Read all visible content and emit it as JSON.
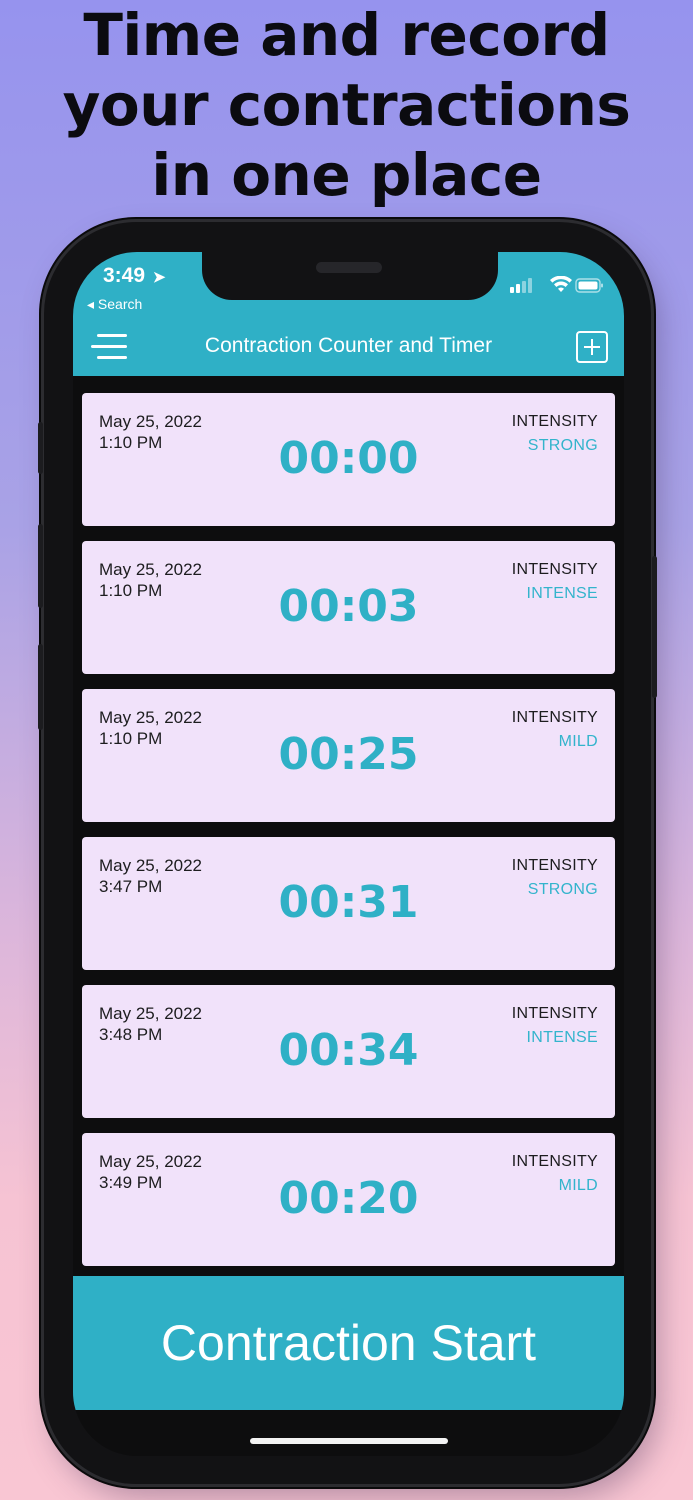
{
  "headline": [
    "Time and record",
    "your contractions",
    "in one place"
  ],
  "status_bar": {
    "time": "3:49",
    "back_label": "◂ Search"
  },
  "app_bar": {
    "title": "Contraction Counter and Timer"
  },
  "intensity_label": "INTENSITY",
  "contractions": [
    {
      "date": "May 25, 2022",
      "time": "1:10 PM",
      "duration": "00:00",
      "intensity": "STRONG"
    },
    {
      "date": "May 25, 2022",
      "time": "1:10 PM",
      "duration": "00:03",
      "intensity": "INTENSE"
    },
    {
      "date": "May 25, 2022",
      "time": "1:10 PM",
      "duration": "00:25",
      "intensity": "MILD"
    },
    {
      "date": "May 25, 2022",
      "time": "3:47 PM",
      "duration": "00:31",
      "intensity": "STRONG"
    },
    {
      "date": "May 25, 2022",
      "time": "3:48 PM",
      "duration": "00:34",
      "intensity": "INTENSE"
    },
    {
      "date": "May 25, 2022",
      "time": "3:49 PM",
      "duration": "00:20",
      "intensity": "MILD"
    }
  ],
  "start_button": {
    "label": "Contraction Start"
  },
  "colors": {
    "accent": "#2fb0c6",
    "card_background": "#f1e2fa",
    "intensity_text": "#33b4cc"
  },
  "icons": [
    "location-arrow-icon",
    "signal-icon",
    "wifi-icon",
    "battery-icon",
    "menu-icon",
    "add-icon"
  ]
}
